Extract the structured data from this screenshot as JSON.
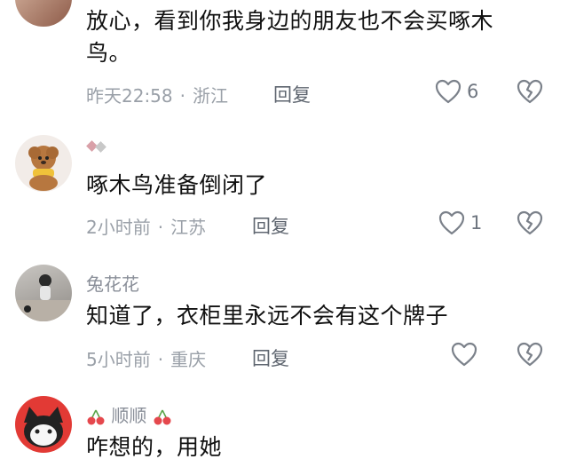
{
  "comments": [
    {
      "text": "放心，看到你我身边的朋友也不会买啄木鸟。",
      "time": "昨天22:58",
      "location": "浙江",
      "reply_label": "回复",
      "like_count": "6"
    },
    {
      "text": "啄木鸟准备倒闭了",
      "time": "2小时前",
      "location": "江苏",
      "reply_label": "回复",
      "like_count": "1"
    },
    {
      "username": "兔花花",
      "text": "知道了，衣柜里永远不会有这个牌子",
      "time": "5小时前",
      "location": "重庆",
      "reply_label": "回复",
      "like_count": ""
    },
    {
      "username": "顺顺",
      "text": "咋想的，用她"
    }
  ],
  "colors": {
    "icon_gray": "#7b818a",
    "meta_gray": "#9aa0a8",
    "cherry_red": "#e5484d",
    "cherry_green": "#5aa54a"
  },
  "icons": [
    "heart-outline-icon",
    "broken-heart-icon",
    "cherry-icon",
    "ribbon-icon"
  ]
}
